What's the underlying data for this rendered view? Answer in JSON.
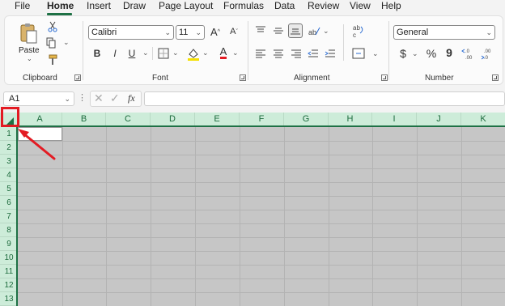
{
  "menu": {
    "items": [
      "File",
      "Home",
      "Insert",
      "Draw",
      "Page Layout",
      "Formulas",
      "Data",
      "Review",
      "View",
      "Help"
    ],
    "active": "Home"
  },
  "ribbon": {
    "clipboard": {
      "paste_label": "Paste",
      "group_label": "Clipboard"
    },
    "font": {
      "font_name": "Calibri",
      "font_size": "11",
      "group_label": "Font",
      "bold": "B",
      "italic": "I",
      "underline": "U",
      "grow": "A",
      "shrink": "A",
      "font_color": "A"
    },
    "alignment": {
      "group_label": "Alignment"
    },
    "number": {
      "format": "General",
      "currency": "$",
      "percent": "%",
      "comma": "9",
      "group_label": "Number"
    }
  },
  "formula_bar": {
    "name_box": "A1",
    "fx": "fx",
    "value": ""
  },
  "sheet": {
    "columns": [
      "A",
      "B",
      "C",
      "D",
      "E",
      "F",
      "G",
      "H",
      "I",
      "J",
      "K"
    ],
    "rows": [
      "1",
      "2",
      "3",
      "4",
      "5",
      "6",
      "7",
      "8",
      "9",
      "10",
      "11",
      "12",
      "13"
    ]
  },
  "colors": {
    "accent": "#1e7145",
    "header_bg": "#cdecd9",
    "grid_bg": "#c6c6c6",
    "annotation": "#e31b23"
  }
}
